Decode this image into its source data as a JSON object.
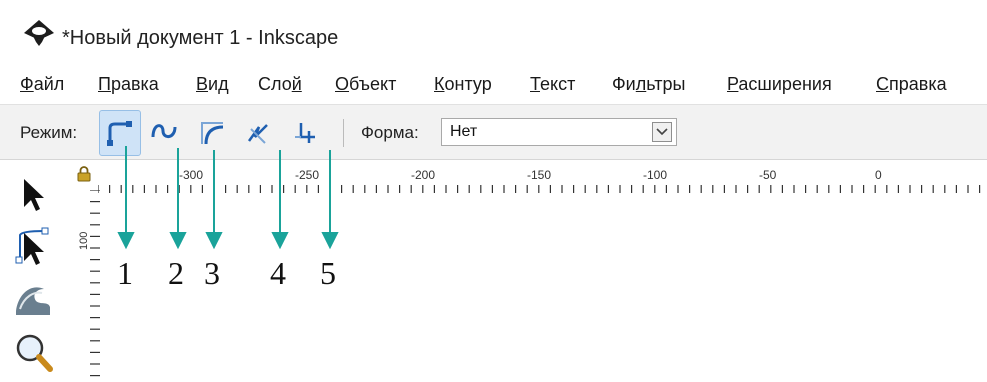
{
  "window": {
    "title": "*Новый документ 1 - Inkscape",
    "icon": "inkscape-logo-icon"
  },
  "menubar": {
    "items": [
      {
        "label_u": "Ф",
        "label_rest": "айл"
      },
      {
        "label_u": "П",
        "label_rest": "равка"
      },
      {
        "label_u": "В",
        "label_rest": "ид"
      },
      {
        "label_pre": "Сло",
        "label_u": "й",
        "label_rest": ""
      },
      {
        "label_u": "О",
        "label_rest": "бъект"
      },
      {
        "label_u": "К",
        "label_rest": "онтур"
      },
      {
        "label_u": "Т",
        "label_rest": "екст"
      },
      {
        "label_pre": "Фи",
        "label_u": "л",
        "label_rest": "ьтры"
      },
      {
        "label_u": "Р",
        "label_rest": "асширения"
      },
      {
        "label_u": "С",
        "label_rest": "правка"
      }
    ]
  },
  "toolbar": {
    "mode_label": "Режим:",
    "modes": [
      {
        "icon": "bezier-mode-icon",
        "active": true
      },
      {
        "icon": "spiro-mode-icon",
        "active": false
      },
      {
        "icon": "bspline-mode-icon",
        "active": false
      },
      {
        "icon": "zigzag-mode-icon",
        "active": false
      },
      {
        "icon": "paraxial-mode-icon",
        "active": false
      }
    ],
    "shape_label": "Форма:",
    "shape_value": "Нет"
  },
  "ruler": {
    "h_labels": [
      "-300",
      "-250",
      "-200",
      "-150",
      "-100",
      "-50",
      "0"
    ],
    "v_label": "100"
  },
  "left_tools": [
    "selector-arrow-icon",
    "node-tool-icon",
    "tweak-tool-icon",
    "zoom-magnifier-icon"
  ],
  "callouts": [
    "1",
    "2",
    "3",
    "4",
    "5"
  ],
  "colors": {
    "accent": "#1aa39a",
    "toolbar_bg": "#f2f2f2",
    "active_button": "#cfe3f7"
  }
}
